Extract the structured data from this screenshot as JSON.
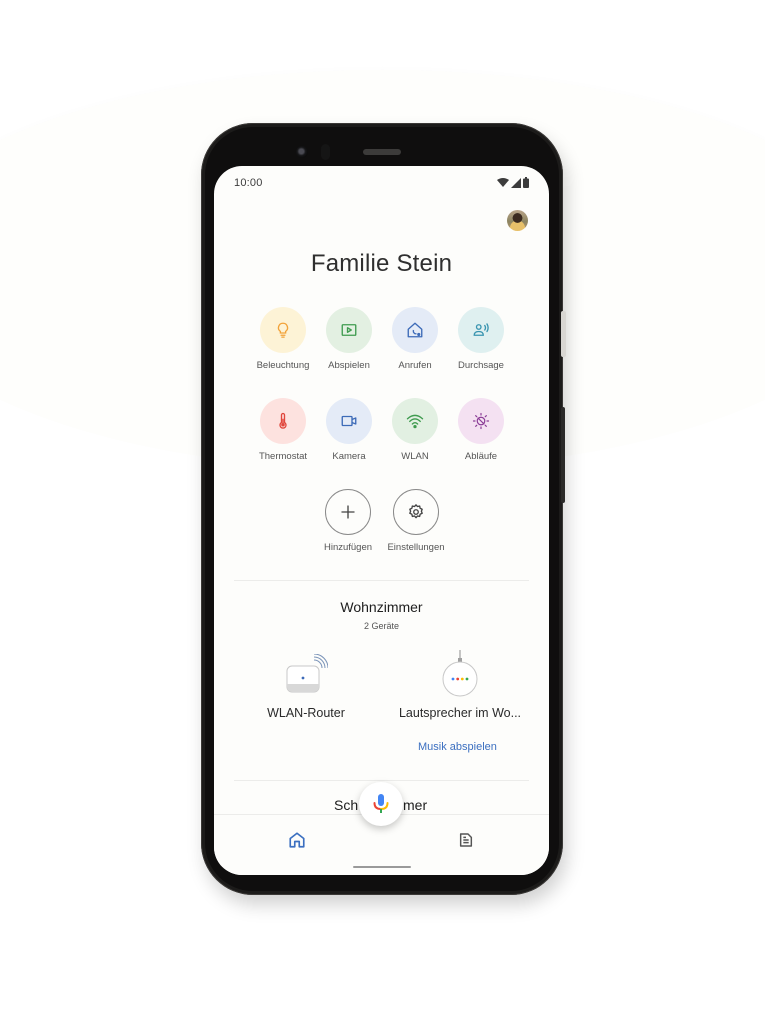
{
  "status_bar": {
    "time": "10:00",
    "icons": [
      "wifi-icon",
      "signal-icon",
      "battery-icon"
    ]
  },
  "header": {
    "title": "Familie Stein",
    "avatar": "profile-avatar"
  },
  "actions": [
    {
      "label": "Beleuchtung",
      "icon": "lightbulb-icon",
      "bg": "#fdf3d6",
      "fg": "#f2a33a"
    },
    {
      "label": "Abspielen",
      "icon": "play-icon",
      "bg": "#e3f0e2",
      "fg": "#3f9b4f"
    },
    {
      "label": "Anrufen",
      "icon": "call-home-icon",
      "bg": "#e4ebf7",
      "fg": "#3d6bb8"
    },
    {
      "label": "Durchsage",
      "icon": "broadcast-icon",
      "bg": "#dff0f0",
      "fg": "#3a95b0"
    },
    {
      "label": "Thermostat",
      "icon": "thermometer-icon",
      "bg": "#fde2df",
      "fg": "#e0463c"
    },
    {
      "label": "Kamera",
      "icon": "camera-icon",
      "bg": "#e4ebf7",
      "fg": "#3d6bb8"
    },
    {
      "label": "WLAN",
      "icon": "wifi-icon",
      "bg": "#e2f0e2",
      "fg": "#3f9b4f"
    },
    {
      "label": "Abläufe",
      "icon": "routines-icon",
      "bg": "#f4e1f2",
      "fg": "#8a3c96"
    },
    {
      "label": "Hinzufügen",
      "icon": "plus-icon"
    },
    {
      "label": "Einstellungen",
      "icon": "gear-icon"
    }
  ],
  "rooms": [
    {
      "name": "Wohnzimmer",
      "subtitle": "2 Geräte",
      "devices": [
        {
          "label": "WLAN-Router",
          "icon": "router-icon"
        },
        {
          "label": "Lautsprecher im Wo...",
          "icon": "speaker-icon",
          "action": "Musik abspielen"
        }
      ]
    },
    {
      "name": "Schlafzimmer",
      "name_left": "Sch",
      "name_right": "mer"
    }
  ],
  "assistant": {
    "icon": "microphone-icon"
  },
  "bottom_nav": [
    {
      "icon": "home-icon",
      "active": true,
      "color": "#3b6fc0"
    },
    {
      "icon": "feed-icon",
      "active": false,
      "color": "#555555"
    }
  ]
}
